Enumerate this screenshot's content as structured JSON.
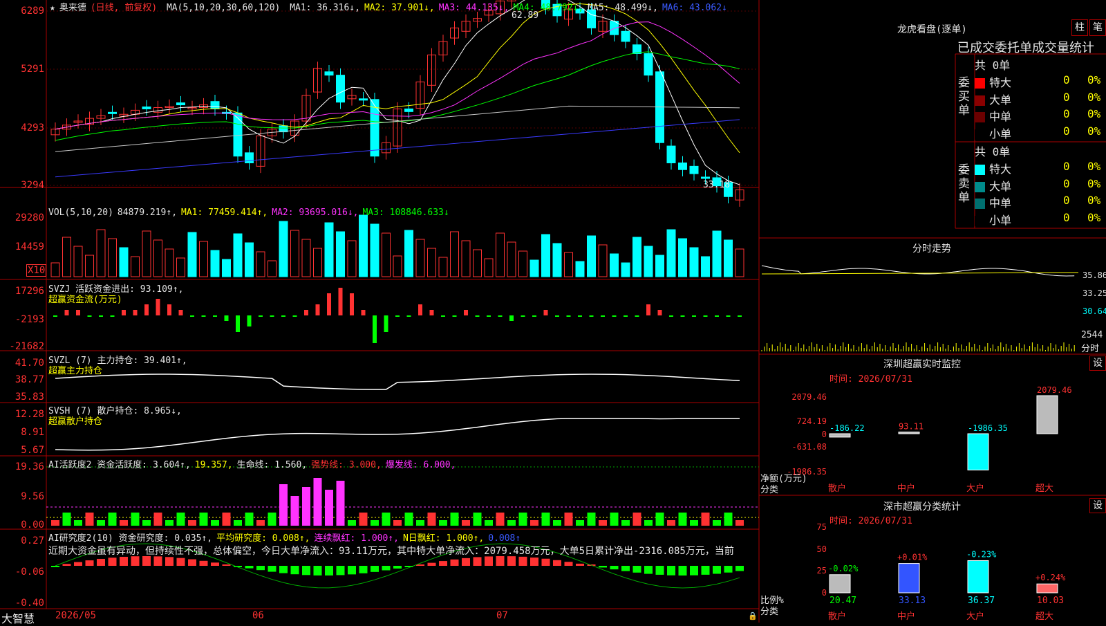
{
  "main": {
    "title_star": "★",
    "stock_name": "奥来德",
    "period": "(日线, 前复权)",
    "ma_label": "MA(5,10,20,30,60,120)",
    "ma1": "MA1: 36.316↓,",
    "ma2": "MA2: 37.901↓,",
    "ma3": "MA3: 44.135↓,",
    "ma4": "MA4: 48.792↓,",
    "ma5": "MA5: 48.499↓,",
    "ma6": "MA6: 43.062↓",
    "y_labels": [
      "6289",
      "5291",
      "4293",
      "3294"
    ],
    "high_label": "62.89",
    "low_label": "33.18"
  },
  "vol": {
    "title": "VOL(5,10,20)",
    "value": "84879.219↑,",
    "ma1": "MA1: 77459.414↑,",
    "ma2": "MA2: 93695.016↓,",
    "ma3": "MA3: 108846.633↓",
    "y_labels": [
      "29280",
      "14459"
    ],
    "unit": "X10"
  },
  "svzj": {
    "title": "SVZJ  活跃资金进出: 93.109↑,",
    "subtitle": "超赢资金流(万元)",
    "y_labels": [
      "17296",
      "-2193",
      "-21682"
    ]
  },
  "svzl": {
    "title": "SVZL (7) 主力持仓: 39.401↑,",
    "subtitle": "超赢主力持仓",
    "y_labels": [
      "41.70",
      "38.77",
      "35.83"
    ]
  },
  "svsh": {
    "title": "SVSH (7) 散户持仓: 8.965↓,",
    "subtitle": "超赢散户持仓",
    "y_labels": [
      "12.28",
      "8.91",
      "5.67"
    ]
  },
  "ai1": {
    "title": "AI活跃度2 资金活跃度: 3.604↑,",
    "v2": "19.357,",
    "v3": "生命线: 1.560,",
    "v4": "强势线: 3.000,",
    "v5": "爆发线: 6.000,",
    "y_labels": [
      "19.36",
      "9.56",
      "0.00"
    ]
  },
  "ai2": {
    "title": "AI研究度2(10) 资金研究度: 0.035↑,",
    "v2": "平均研究度: 0.008↑,",
    "v3": "连续飘红: 1.000↑,",
    "v4": "N日飘红: 1.000↑,",
    "v5": "0.008↑",
    "comment": "近期大资金虽有异动，但持续性不强，总体偏空，今日大单净流入：93.11万元，其中特大单净流入：2079.458万元，大单5日累计净出-2316.085万元，当前",
    "y_labels": [
      "0.27",
      "-0.06",
      "-0.40"
    ]
  },
  "xaxis": {
    "brand": "大智慧",
    "dates": [
      "2026/05",
      "06",
      "07"
    ]
  },
  "right": {
    "lhb_title": "龙虎看盘(逐单)",
    "btn_zhu": "柱",
    "btn_bi": "笔",
    "subtitle": "已成交委托单成交量统计",
    "buy_label": "委买单",
    "sell_label": "委卖单",
    "buy_total": "共 0单",
    "sell_total": "共 0单",
    "buy_rows": [
      {
        "name": "特大",
        "count": "0",
        "pct": "0%",
        "color": "#ff0000"
      },
      {
        "name": "大单",
        "count": "0",
        "pct": "0%",
        "color": "#8b0000"
      },
      {
        "name": "中单",
        "count": "0",
        "pct": "0%",
        "color": "#6b0000"
      },
      {
        "name": "小单",
        "count": "0",
        "pct": "0%",
        "color": "#000000"
      }
    ],
    "sell_rows": [
      {
        "name": "特大",
        "count": "0",
        "pct": "0%",
        "color": "#00ffff"
      },
      {
        "name": "大单",
        "count": "0",
        "pct": "0%",
        "color": "#008b8b"
      },
      {
        "name": "中单",
        "count": "0",
        "pct": "0%",
        "color": "#007070"
      },
      {
        "name": "小单",
        "count": "0",
        "pct": "0%",
        "color": "#000000"
      }
    ],
    "fenshi_title": "分时走势",
    "fenshi_labels": [
      "35.86",
      "33.25",
      "30.64",
      "2544",
      "分时"
    ],
    "monitor_title": "深圳超赢实时监控",
    "monitor_btn": "设",
    "monitor_time": "时间: 2026/07/31",
    "monitor_y": [
      "2079.46",
      "724.19",
      "0",
      "-631.08",
      "-1986.35"
    ],
    "monitor_axis1": "净额(万元)",
    "monitor_axis2": "分类",
    "monitor_cats": [
      "散户",
      "中户",
      "大户",
      "超大"
    ],
    "monitor_values": [
      "-186.22",
      "93.11",
      "-1986.35",
      "2079.46"
    ],
    "stats_title": "深市超赢分类统计",
    "stats_btn": "设",
    "stats_time": "时间: 2026/07/31",
    "stats_y": [
      "75",
      "50",
      "25",
      "0"
    ],
    "stats_axis1": "比例%",
    "stats_axis2": "分类",
    "stats_cats": [
      "散户",
      "中户",
      "大户",
      "超大"
    ],
    "stats_values": [
      "20.47",
      "33.13",
      "36.37",
      "10.03"
    ],
    "stats_changes": [
      "-0.02%",
      "+0.01%",
      "-0.23%",
      "+0.24%"
    ]
  },
  "colors": {
    "up": "#ff3232",
    "down": "#00ffff",
    "grid": "#aa0000",
    "ma1": "#ffffff",
    "ma2": "#ffff00",
    "ma3": "#ff33ff",
    "ma4": "#00ff00",
    "ma5": "#c8c8c8",
    "ma6": "#3a3aff"
  }
}
